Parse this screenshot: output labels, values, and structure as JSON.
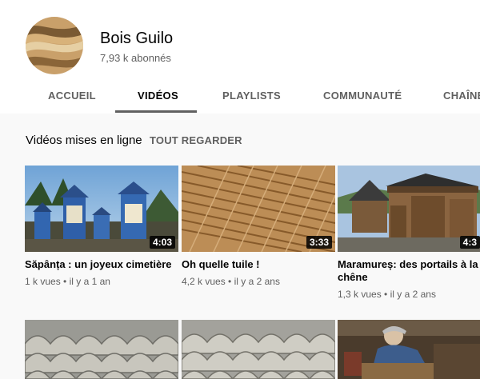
{
  "channel": {
    "name": "Bois Guilo",
    "subscribers": "7,93 k abonnés"
  },
  "tabs": [
    {
      "label": "ACCUEIL"
    },
    {
      "label": "VIDÉOS"
    },
    {
      "label": "PLAYLISTS"
    },
    {
      "label": "COMMUNAUTÉ"
    },
    {
      "label": "CHAÎNE"
    }
  ],
  "section": {
    "title": "Vidéos mises en ligne",
    "see_all": "TOUT REGARDER"
  },
  "videos": [
    {
      "title": "Săpânța : un joyeux cimetière",
      "duration": "4:03",
      "views": "1 k vues",
      "age": "il y a 1 an"
    },
    {
      "title": "Oh quelle tuile !",
      "duration": "3:33",
      "views": "4,2 k vues",
      "age": "il y a 2 ans"
    },
    {
      "title": "Maramureș: des portails à la chêne",
      "duration": "4:3",
      "views": "1,3 k vues",
      "age": "il y a 2 ans"
    }
  ],
  "colors": {
    "background": "#f9f9f9",
    "header": "#ffffff",
    "text_primary": "#030303",
    "text_secondary": "#606060"
  }
}
